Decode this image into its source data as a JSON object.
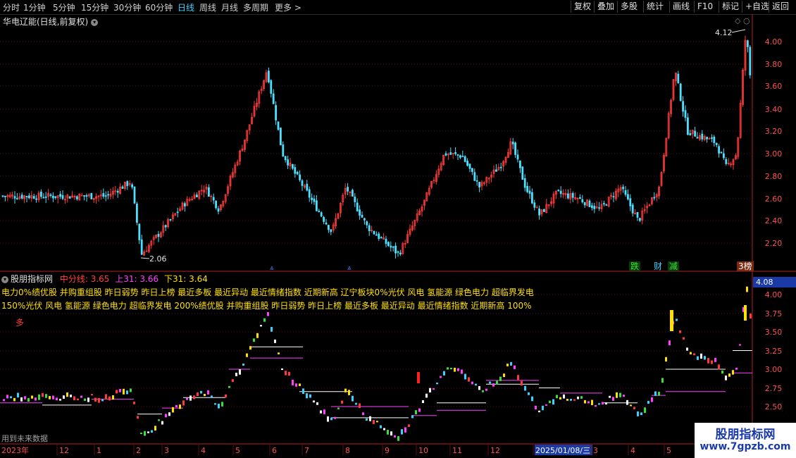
{
  "periods": [
    "分时",
    "1分钟",
    "5分钟",
    "15分钟",
    "30分钟",
    "60分钟",
    "日线",
    "周线",
    "月线",
    "多周期",
    "更多"
  ],
  "active_period": "日线",
  "toolbar_right": [
    "复权",
    "叠加",
    "多股",
    "统计",
    "画线",
    "F10",
    "标记",
    "+自选",
    "返回"
  ],
  "main": {
    "title": "华电辽能(日线,前复权)",
    "high_label": "4.12",
    "low_label": "2.06",
    "y_ticks": [
      "4.00",
      "3.80",
      "3.60",
      "3.40",
      "3.20",
      "3.00",
      "2.80",
      "2.60",
      "2.40",
      "2.20"
    ],
    "tags": [
      {
        "text": "跌",
        "color": "#3ae03a"
      },
      {
        "text": "财",
        "color": "#3ad0ff"
      },
      {
        "text": "减",
        "color": "#3ae03a"
      },
      {
        "text": "3榜",
        "color": "#ffffff"
      }
    ]
  },
  "indicator": {
    "name": "股朋指标网",
    "mid_label": "中分线:",
    "mid_value": "3.65",
    "up_label": "上31:",
    "up_value": "3.66",
    "down_label": "下31:",
    "down_value": "3.64",
    "line1": "电力0%绩优股 并购重组股 昨日弱势 昨日上榜 最近多板 最近异动 最近情绪指数 近期新高 辽宁板块0%光伏 风电 氢能源 绿色电力 超临界发电",
    "line2": "150%光伏 风电 氢能源 绿色电力 超临界发电 200%绩优股 并购重组股 昨日弱势 昨日上榜 最近多板 最近异动 最近情绪指数 近期新高 100%",
    "duo_label": "多",
    "current_price": "4.08",
    "y_ticks": [
      "4.00",
      "3.75",
      "3.50",
      "3.25",
      "3.00",
      "2.75",
      "2.50"
    ],
    "future_label": "用到未来数据"
  },
  "time_axis": {
    "labels": [
      "2023年",
      "12",
      "1",
      "2",
      "3",
      "4",
      "5",
      "6",
      "7",
      "8",
      "9",
      "10",
      "11",
      "12",
      "2025/01/08/三",
      "3",
      "4",
      "5"
    ]
  },
  "watermark": {
    "site_name": "股朋指标网",
    "url": "www.7gpzb.com"
  },
  "colors": {
    "up": "#ff3a3a",
    "down": "#4ae0ff",
    "active_period": "#3ad0ff",
    "mid_line": "#ff4040",
    "up31": "#ff40ff",
    "label_yellow": "#ffe000"
  }
}
